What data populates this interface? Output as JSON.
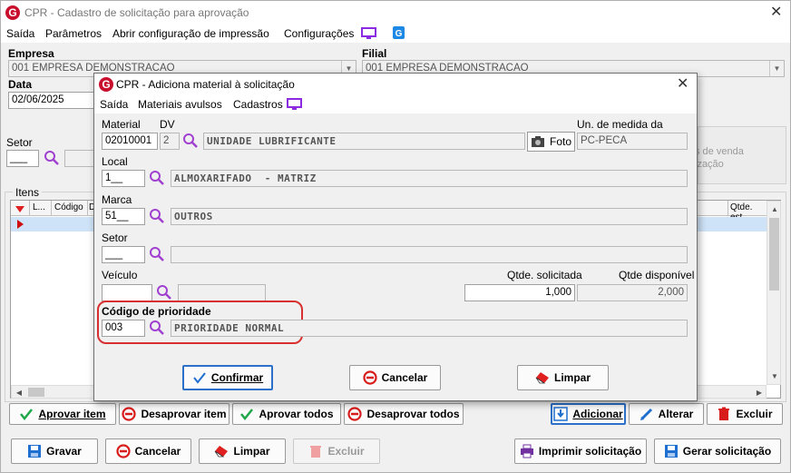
{
  "main": {
    "title": "CPR - Cadastro de solicitação para aprovação",
    "close_glyph": "✕",
    "menu": [
      "Saída",
      "Parâmetros",
      "Abrir configuração de impressão",
      "Configurações"
    ],
    "empresa_label": "Empresa",
    "empresa_value": "001 EMPRESA DEMONSTRACAO",
    "filial_label": "Filial",
    "filial_value": "001 EMPRESA DEMONSTRACAO",
    "data_label": "Data",
    "data_value": "02/06/2025",
    "setor_label": "Setor",
    "setor_value": "___",
    "itens_label": "Itens",
    "grid_columns": [
      "L...",
      "Código",
      "D",
      "Qtde. est"
    ],
    "side_text": [
      "s de venda",
      "ização"
    ],
    "row_buttons": {
      "aprovar_item": "Aprovar item",
      "desaprovar_item": "Desaprovar item",
      "aprovar_todos": "Aprovar todos",
      "desaprovar_todos": "Desaprovar todos",
      "adicionar": "Adicionar",
      "alterar": "Alterar",
      "excluir": "Excluir"
    },
    "bottom_buttons": {
      "gravar": "Gravar",
      "cancelar": "Cancelar",
      "limpar": "Limpar",
      "excluir": "Excluir",
      "imprimir": "Imprimir solicitação",
      "gerar": "Gerar solicitação"
    }
  },
  "dialog": {
    "title": "CPR - Adiciona material à solicitação",
    "close_glyph": "✕",
    "menu": [
      "Saída",
      "Materiais avulsos",
      "Cadastros"
    ],
    "material_label": "Material",
    "material_value": "02010001",
    "dv_label": "DV",
    "dv_value": "2",
    "material_desc": "UNIDADE LUBRIFICANTE",
    "foto_label": "Foto",
    "un_medida_label": "Un. de medida da compra",
    "un_medida_value": "PC-PECA",
    "local_label": "Local",
    "local_value": "1__",
    "local_desc": "ALMOXARIFADO  - MATRIZ",
    "marca_label": "Marca",
    "marca_value": "51__",
    "marca_desc": "OUTROS",
    "setor_label": "Setor",
    "setor_value": "___",
    "setor_desc": "",
    "veiculo_label": "Veículo",
    "veiculo_value": "",
    "qtde_solicitada_label": "Qtde. solicitada",
    "qtde_solicitada_value": "1,000",
    "qtde_disponivel_label": "Qtde disponível",
    "qtde_disponivel_value": "2,000",
    "prioridade_label": "Código de prioridade",
    "prioridade_value": "003",
    "prioridade_desc": "PRIORIDADE NORMAL",
    "buttons": {
      "confirmar": "Confirmar",
      "cancelar": "Cancelar",
      "limpar": "Limpar"
    }
  },
  "colors": {
    "brand_red": "#c8102e",
    "accent_blue": "#2c70c8",
    "green_check": "#1fa84a",
    "magnifier": "#a040d0",
    "highlight": "#d83030"
  }
}
